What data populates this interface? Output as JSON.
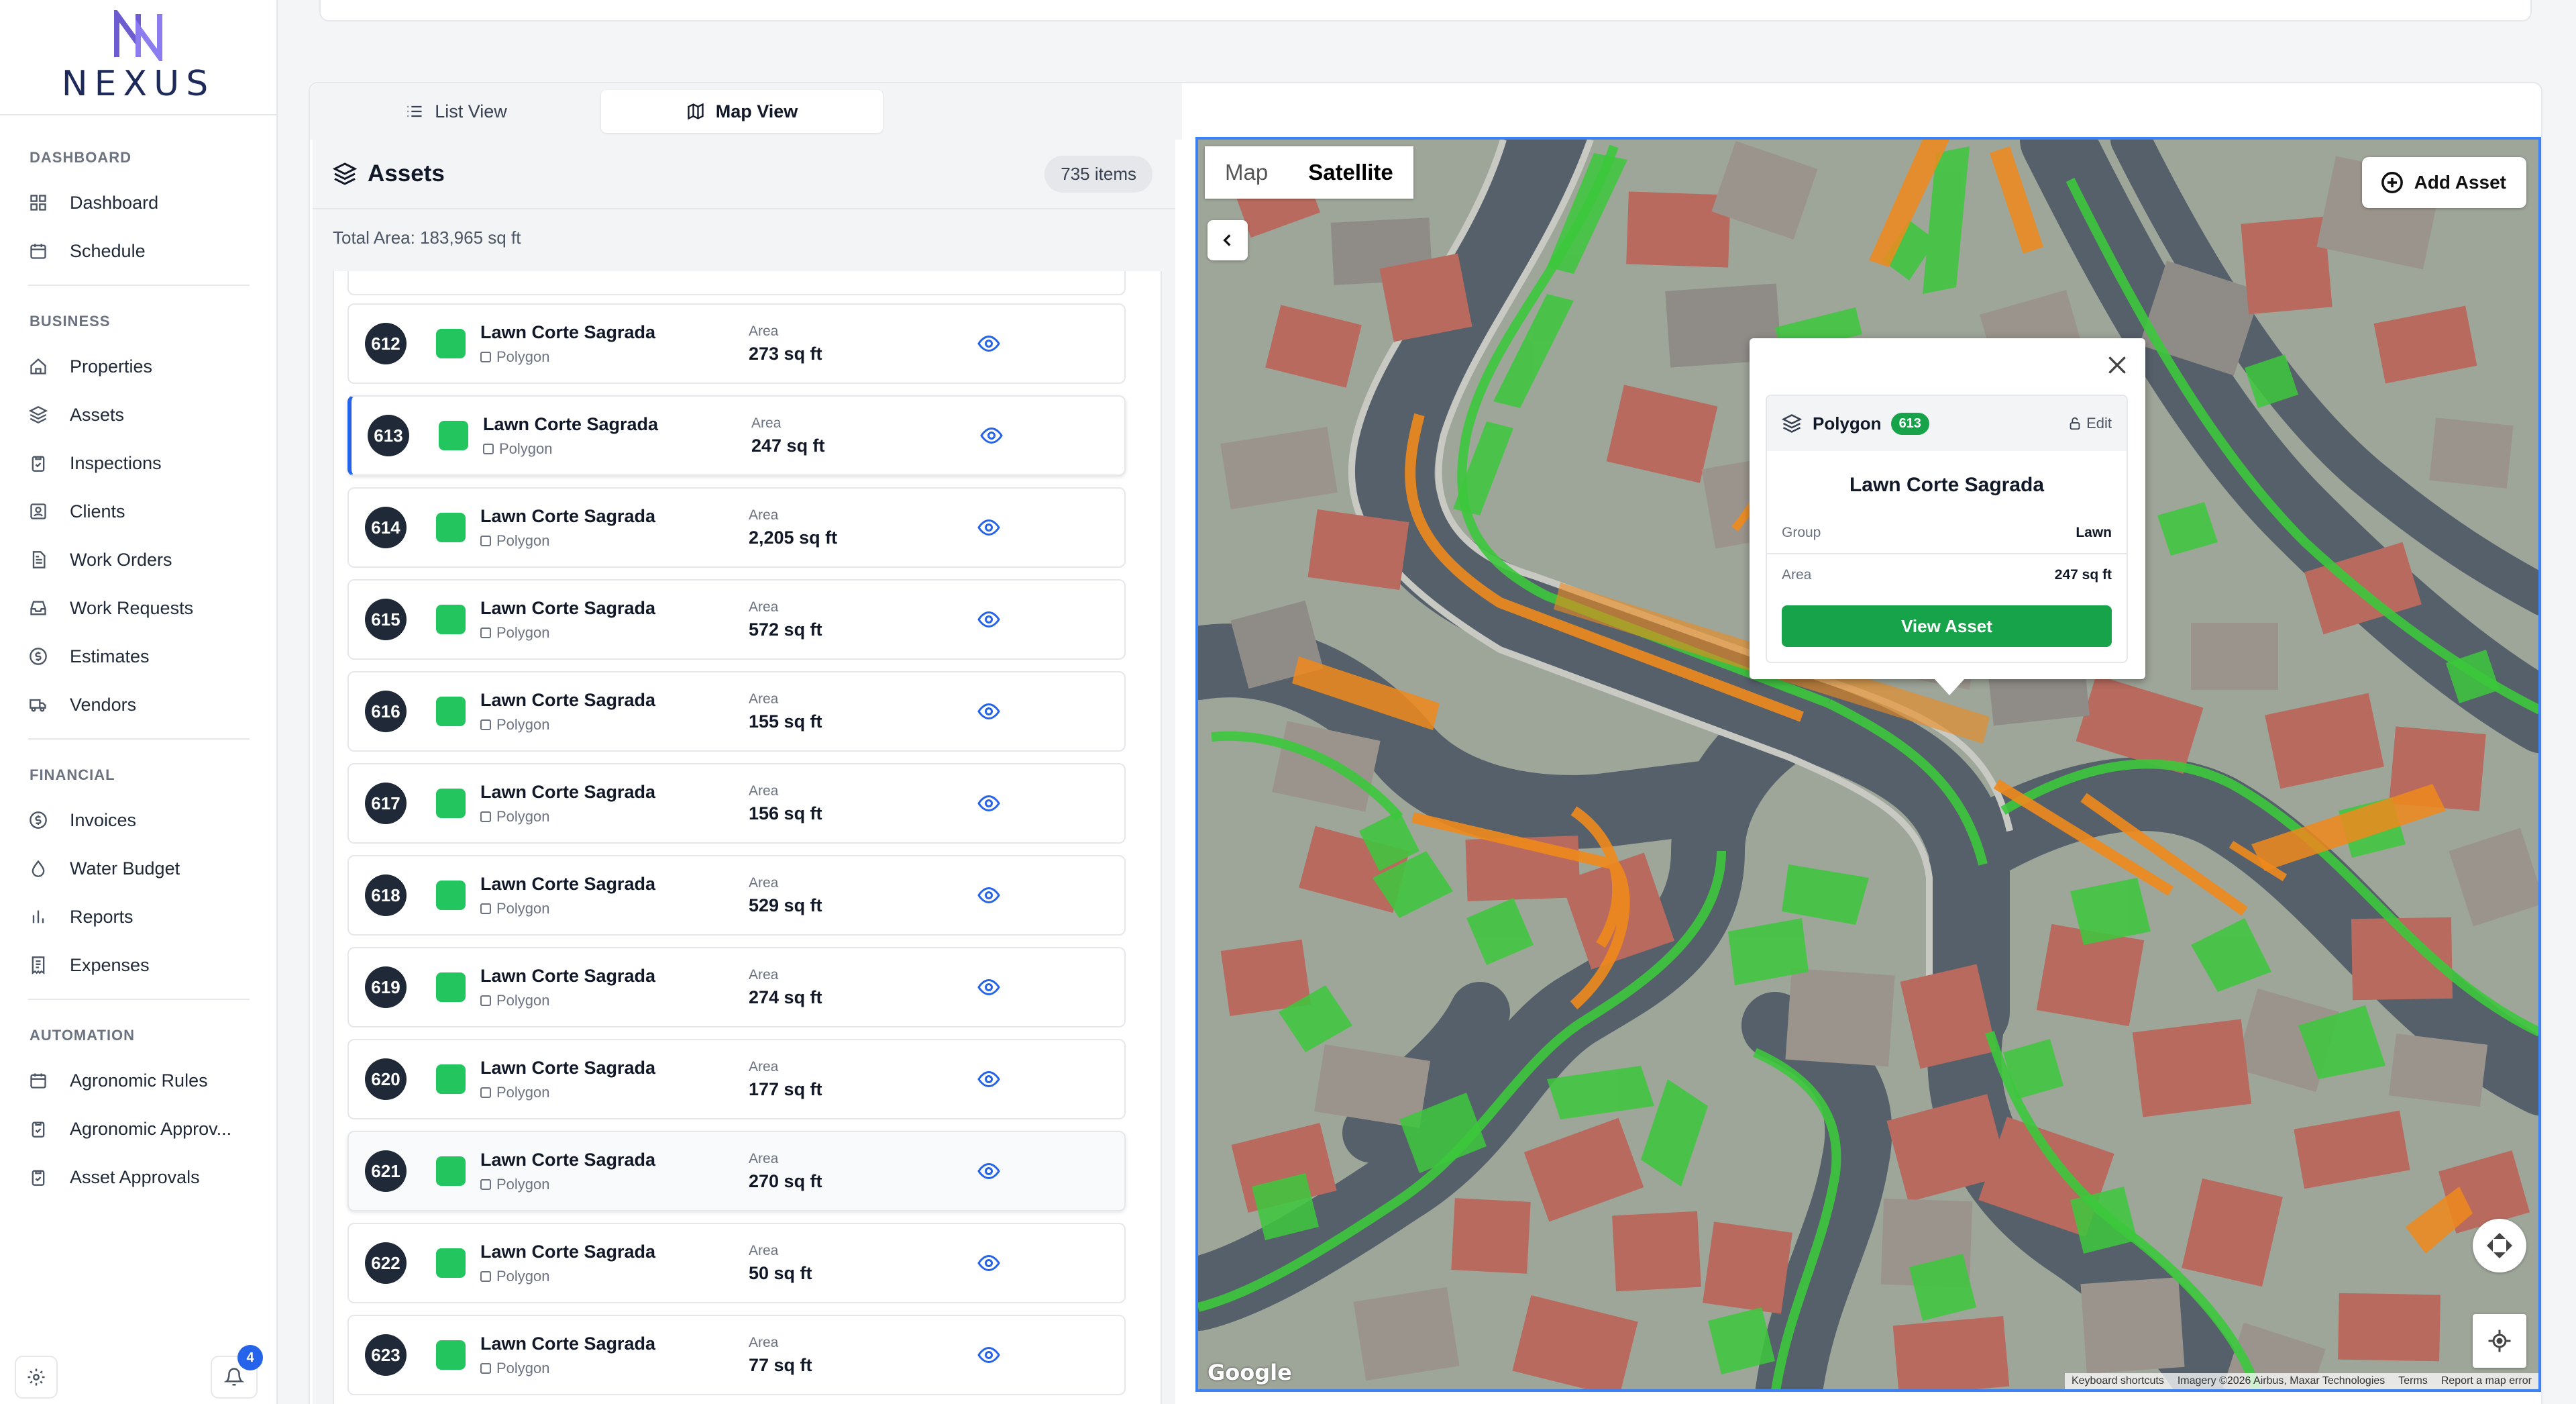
{
  "brand": {
    "name": "NEXUS"
  },
  "sidebar": {
    "sections": [
      {
        "title": "DASHBOARD",
        "items": [
          "Dashboard",
          "Schedule"
        ]
      },
      {
        "title": "BUSINESS",
        "items": [
          "Properties",
          "Assets",
          "Inspections",
          "Clients",
          "Work Orders",
          "Work Requests",
          "Estimates",
          "Vendors"
        ]
      },
      {
        "title": "FINANCIAL",
        "items": [
          "Invoices",
          "Water Budget",
          "Reports",
          "Expenses"
        ]
      },
      {
        "title": "AUTOMATION",
        "items": [
          "Agronomic Rules",
          "Agronomic Approv...",
          "Asset Approvals"
        ]
      }
    ],
    "notifications_count": "4"
  },
  "tabs": {
    "list": "List View",
    "map": "Map View",
    "active": "map"
  },
  "assets": {
    "title": "Assets",
    "count": "735 items",
    "total_area": "Total Area: 183,965 sq ft",
    "area_label": "Area",
    "rows": [
      {
        "num": "612",
        "name": "Lawn Corte Sagrada",
        "type": "Polygon",
        "area": "273 sq ft"
      },
      {
        "num": "613",
        "name": "Lawn Corte Sagrada",
        "type": "Polygon",
        "area": "247 sq ft"
      },
      {
        "num": "614",
        "name": "Lawn Corte Sagrada",
        "type": "Polygon",
        "area": "2,205 sq ft"
      },
      {
        "num": "615",
        "name": "Lawn Corte Sagrada",
        "type": "Polygon",
        "area": "572 sq ft"
      },
      {
        "num": "616",
        "name": "Lawn Corte Sagrada",
        "type": "Polygon",
        "area": "155 sq ft"
      },
      {
        "num": "617",
        "name": "Lawn Corte Sagrada",
        "type": "Polygon",
        "area": "156 sq ft"
      },
      {
        "num": "618",
        "name": "Lawn Corte Sagrada",
        "type": "Polygon",
        "area": "529 sq ft"
      },
      {
        "num": "619",
        "name": "Lawn Corte Sagrada",
        "type": "Polygon",
        "area": "274 sq ft"
      },
      {
        "num": "620",
        "name": "Lawn Corte Sagrada",
        "type": "Polygon",
        "area": "177 sq ft"
      },
      {
        "num": "621",
        "name": "Lawn Corte Sagrada",
        "type": "Polygon",
        "area": "270 sq ft"
      },
      {
        "num": "622",
        "name": "Lawn Corte Sagrada",
        "type": "Polygon",
        "area": "50 sq ft"
      },
      {
        "num": "623",
        "name": "Lawn Corte Sagrada",
        "type": "Polygon",
        "area": "77 sq ft"
      }
    ],
    "swatch_color": "#22c55e",
    "selected_num": "613"
  },
  "map": {
    "type_map": "Map",
    "type_satellite": "Satellite",
    "active_type": "Satellite",
    "add_asset": "Add Asset",
    "google": "Google",
    "attribution": [
      "Keyboard shortcuts",
      "Imagery ©2026 Airbus, Maxar Technologies",
      "Terms",
      "Report a map error"
    ],
    "popup": {
      "type": "Polygon",
      "badge": "613",
      "edit": "Edit",
      "title": "Lawn Corte Sagrada",
      "group_label": "Group",
      "group_value": "Lawn",
      "area_label": "Area",
      "area_value": "247 sq ft",
      "button": "View Asset"
    },
    "colors": {
      "lawn": "#3cc83c",
      "orange": "#f08a1c",
      "accent": "#16a34a"
    }
  }
}
